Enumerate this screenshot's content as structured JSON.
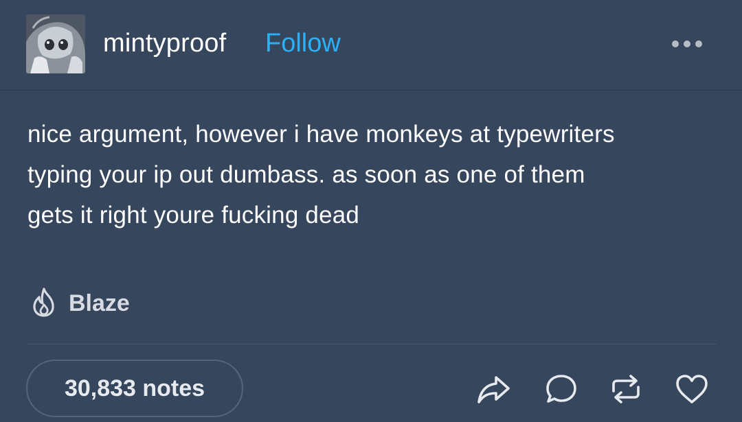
{
  "post": {
    "username": "mintyproof",
    "follow_label": "Follow",
    "body_lines": [
      "nice argument, however i have monkeys at typewriters",
      "typing your ip out dumbass. as soon as one of them",
      "gets it right youre fucking dead"
    ],
    "blaze_label": "Blaze",
    "notes_label": "30,833 notes"
  },
  "icons": {
    "more": "more-dots-icon",
    "blaze": "flame-icon",
    "share": "share-arrow-icon",
    "reply": "speech-bubble-icon",
    "reblog": "reblog-icon",
    "like": "heart-icon"
  },
  "colors": {
    "background": "#36465d",
    "follow": "#2ab1f7",
    "text": "#ffffff"
  }
}
